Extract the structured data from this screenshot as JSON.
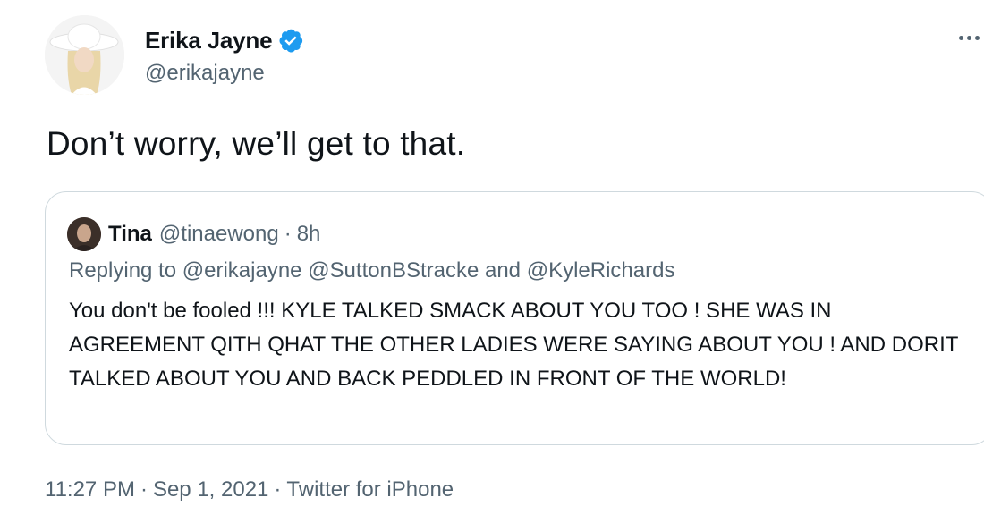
{
  "author": {
    "display_name": "Erika Jayne",
    "handle": "@erikajayne",
    "verified": true
  },
  "tweet_text": "Don’t worry, we’ll get to that.",
  "quoted": {
    "name": "Tina",
    "handle": "@tinaewong",
    "separator": "·",
    "time": "8h",
    "replying_prefix": "Replying to",
    "replying_mentions": [
      "@erikajayne",
      "@SuttonBStracke",
      "@KyleRichards"
    ],
    "replying_and": "and",
    "body": "You don't be fooled !!! KYLE TALKED SMACK ABOUT YOU TOO ! SHE WAS IN AGREEMENT QITH QHAT THE OTHER LADIES WERE SAYING ABOUT YOU ! AND DORIT TALKED ABOUT YOU AND BACK PEDDLED IN FRONT OF THE WORLD!"
  },
  "meta": {
    "time": "11:27 PM",
    "date": "Sep 1, 2021",
    "source": "Twitter for iPhone",
    "separator": "·"
  },
  "colors": {
    "verified_badge": "#1d9bf0",
    "secondary_text": "#536471",
    "primary_text": "#0f1419",
    "border": "#cfd9de"
  }
}
